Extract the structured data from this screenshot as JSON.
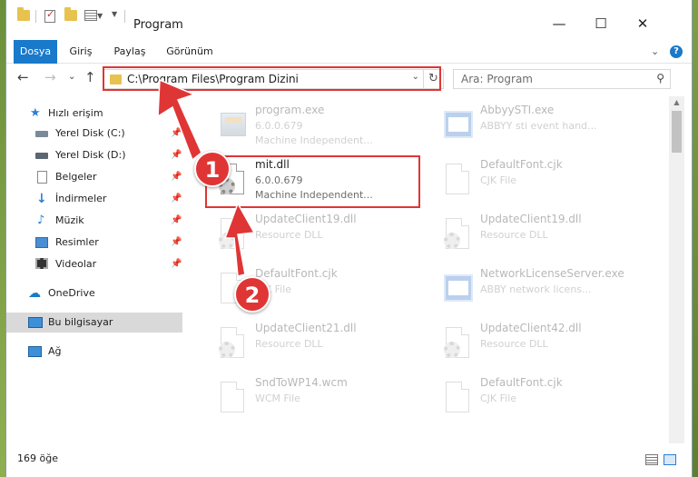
{
  "window": {
    "title": "Program",
    "controls": {
      "minimize": "—",
      "maximize": "☐",
      "close": "✕"
    }
  },
  "ribbon": {
    "tabs": [
      {
        "label": "Dosya",
        "active": true
      },
      {
        "label": "Giriş",
        "active": false
      },
      {
        "label": "Paylaş",
        "active": false
      },
      {
        "label": "Görünüm",
        "active": false
      }
    ],
    "help": "?"
  },
  "nav": {
    "back": "←",
    "forward": "→",
    "recent": "⌄",
    "up": "↑",
    "address": "C:\\Program Files\\Program Dizini",
    "search_placeholder": "Ara: Program"
  },
  "sidebar": {
    "quick_access": "Hızlı erişim",
    "items": [
      {
        "label": "Yerel Disk (C:)",
        "pinned": true
      },
      {
        "label": "Yerel Disk (D:)",
        "pinned": true
      },
      {
        "label": "Belgeler",
        "pinned": true
      },
      {
        "label": "İndirmeler",
        "pinned": true
      },
      {
        "label": "Müzik",
        "pinned": true
      },
      {
        "label": "Resimler",
        "pinned": true
      },
      {
        "label": "Videolar",
        "pinned": true
      }
    ],
    "onedrive": "OneDrive",
    "this_pc": "Bu bilgisayar",
    "network": "Ağ"
  },
  "files": [
    {
      "name": "program.exe",
      "line1": "6.0.0.679",
      "line2": "Machine Independent...",
      "icon": "exe-icon",
      "faded": true
    },
    {
      "name": "AbbyySTI.exe",
      "line1": "ABBYY sti event hand...",
      "line2": "",
      "icon": "app-icon",
      "faded": true
    },
    {
      "name": "mit.dll",
      "line1": "6.0.0.679",
      "line2": "Machine Independent...",
      "icon": "dll-icon",
      "faded": false
    },
    {
      "name": "DefaultFont.cjk",
      "line1": "CJK File",
      "line2": "",
      "icon": "file-icon",
      "faded": true
    },
    {
      "name": "UpdateClient19.dll",
      "line1": "Resource DLL",
      "line2": "",
      "icon": "dll-icon",
      "faded": true
    },
    {
      "name": "UpdateClient19.dll",
      "line1": "Resource DLL",
      "line2": "",
      "icon": "dll-icon",
      "faded": true
    },
    {
      "name": "DefaultFont.cjk",
      "line1": "CJK File",
      "line2": "",
      "icon": "file-icon",
      "faded": true
    },
    {
      "name": "NetworkLicenseServer.exe",
      "line1": "ABBY network licens...",
      "line2": "",
      "icon": "app-icon",
      "faded": true
    },
    {
      "name": "UpdateClient21.dll",
      "line1": "Resource DLL",
      "line2": "",
      "icon": "dll-icon",
      "faded": true
    },
    {
      "name": "UpdateClient42.dll",
      "line1": "Resource DLL",
      "line2": "",
      "icon": "dll-icon",
      "faded": true
    },
    {
      "name": "SndToWP14.wcm",
      "line1": "WCM File",
      "line2": "",
      "icon": "file-icon",
      "faded": true
    },
    {
      "name": "DefaultFont.cjk",
      "line1": "CJK File",
      "line2": "",
      "icon": "file-icon",
      "faded": true
    }
  ],
  "annotations": {
    "step1": "1",
    "step2": "2",
    "color": "#e03535"
  },
  "status": {
    "count": "169 öğe"
  },
  "colors": {
    "accent": "#1979ca",
    "folder": "#e8c24e"
  }
}
